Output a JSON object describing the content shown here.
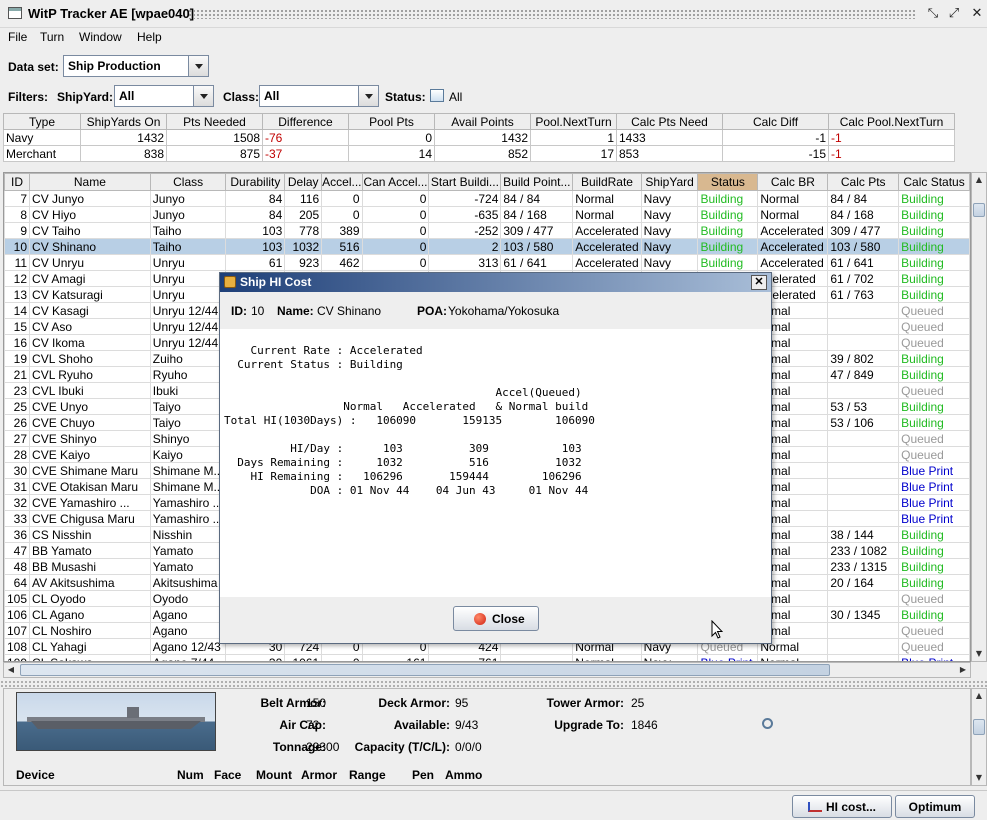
{
  "window": {
    "title": "WitP Tracker AE [wpae040]"
  },
  "menu": [
    "File",
    "Turn",
    "Window",
    "Help"
  ],
  "dataset": {
    "label": "Data set:",
    "value": "Ship Production"
  },
  "filters": {
    "label": "Filters:",
    "shipyard_label": "ShipYard:",
    "shipyard_value": "All",
    "class_label": "Class:",
    "class_value": "All",
    "status_label": "Status:",
    "status_value": "All"
  },
  "summary": {
    "headers": [
      "Type",
      "ShipYards On",
      "Pts Needed",
      "Difference",
      "Pool Pts",
      "Avail Points",
      "Pool.NextTurn",
      "Calc Pts Need",
      "Calc Diff",
      "Calc Pool.NextTurn"
    ],
    "rows": [
      [
        "Navy",
        "1432",
        "1508",
        "-76",
        "0",
        "1432",
        "1",
        "1433",
        "-1",
        "-1"
      ],
      [
        "Merchant",
        "838",
        "875",
        "-37",
        "14",
        "852",
        "17",
        "853",
        "-15",
        "-1"
      ]
    ]
  },
  "table": {
    "headers": [
      "ID",
      "Name",
      "Class",
      "Durability",
      "Delay",
      "Accel...",
      "Can Accel...",
      "Start Buildi...",
      "Build Point...",
      "BuildRate",
      "ShipYard",
      "Status",
      "Calc BR",
      "Calc Pts",
      "Calc Status"
    ],
    "rows": [
      [
        "7",
        "CV Junyo",
        "Junyo",
        "84",
        "116",
        "0",
        "0",
        "-724",
        "84 / 84",
        "Normal",
        "Navy",
        "Building",
        "Normal",
        "84 / 84",
        "Building"
      ],
      [
        "8",
        "CV Hiyo",
        "Junyo",
        "84",
        "205",
        "0",
        "0",
        "-635",
        "84 / 168",
        "Normal",
        "Navy",
        "Building",
        "Normal",
        "84 / 168",
        "Building"
      ],
      [
        "9",
        "CV Taiho",
        "Taiho",
        "103",
        "778",
        "389",
        "0",
        "-252",
        "309 / 477",
        "Accelerated",
        "Navy",
        "Building",
        "Accelerated",
        "309 / 477",
        "Building"
      ],
      [
        "10",
        "CV Shinano",
        "Taiho",
        "103",
        "1032",
        "516",
        "0",
        "2",
        "103 / 580",
        "Accelerated",
        "Navy",
        "Building",
        "Accelerated",
        "103 / 580",
        "Building"
      ],
      [
        "11",
        "CV Unryu",
        "Unryu",
        "61",
        "923",
        "462",
        "0",
        "313",
        "61 / 641",
        "Accelerated",
        "Navy",
        "Building",
        "Accelerated",
        "61 / 641",
        "Building"
      ],
      [
        "12",
        "CV Amagi",
        "Unryu",
        "",
        "",
        "",
        "",
        "",
        "",
        "",
        "",
        "",
        "ccelerated",
        "61 / 702",
        "Building"
      ],
      [
        "13",
        "CV Katsuragi",
        "Unryu",
        "",
        "",
        "",
        "",
        "",
        "",
        "",
        "",
        "",
        "ccelerated",
        "61 / 763",
        "Building"
      ],
      [
        "14",
        "CV Kasagi",
        "Unryu 12/44",
        "",
        "",
        "",
        "",
        "",
        "",
        "",
        "",
        "",
        "ormal",
        "",
        "Queued"
      ],
      [
        "15",
        "CV Aso",
        "Unryu 12/44",
        "",
        "",
        "",
        "",
        "",
        "",
        "",
        "",
        "",
        "ormal",
        "",
        "Queued"
      ],
      [
        "16",
        "CV Ikoma",
        "Unryu 12/44",
        "",
        "",
        "",
        "",
        "",
        "",
        "",
        "",
        "",
        "ormal",
        "",
        "Queued"
      ],
      [
        "19",
        "CVL Shoho",
        "Zuiho",
        "",
        "",
        "",
        "",
        "",
        "",
        "",
        "",
        "",
        "ormal",
        "39 / 802",
        "Building"
      ],
      [
        "21",
        "CVL Ryuho",
        "Ryuho",
        "",
        "",
        "",
        "",
        "",
        "",
        "",
        "",
        "",
        "ormal",
        "47 / 849",
        "Building"
      ],
      [
        "23",
        "CVL Ibuki",
        "Ibuki",
        "",
        "",
        "",
        "",
        "",
        "",
        "",
        "",
        "",
        "ormal",
        "",
        "Queued"
      ],
      [
        "25",
        "CVE Unyo",
        "Taiyo",
        "",
        "",
        "",
        "",
        "",
        "",
        "",
        "",
        "",
        "ormal",
        "53 / 53",
        "Building"
      ],
      [
        "26",
        "CVE Chuyo",
        "Taiyo",
        "",
        "",
        "",
        "",
        "",
        "",
        "",
        "",
        "",
        "ormal",
        "53 / 106",
        "Building"
      ],
      [
        "27",
        "CVE Shinyo",
        "Shinyo",
        "",
        "",
        "",
        "",
        "",
        "",
        "",
        "",
        "",
        "ormal",
        "",
        "Queued"
      ],
      [
        "28",
        "CVE Kaiyo",
        "Kaiyo",
        "",
        "",
        "",
        "",
        "",
        "",
        "",
        "",
        "",
        "ormal",
        "",
        "Queued"
      ],
      [
        "30",
        "CVE Shimane Maru",
        "Shimane M...",
        "",
        "",
        "",
        "",
        "",
        "",
        "",
        "",
        "",
        "ormal",
        "",
        "Blue Print"
      ],
      [
        "31",
        "CVE Otakisan Maru",
        "Shimane M...",
        "",
        "",
        "",
        "",
        "",
        "",
        "",
        "",
        "",
        "ormal",
        "",
        "Blue Print"
      ],
      [
        "32",
        "CVE Yamashiro ...",
        "Yamashiro ...",
        "",
        "",
        "",
        "",
        "",
        "",
        "",
        "",
        "",
        "ormal",
        "",
        "Blue Print"
      ],
      [
        "33",
        "CVE Chigusa Maru",
        "Yamashiro ...",
        "",
        "",
        "",
        "",
        "",
        "",
        "",
        "",
        "",
        "ormal",
        "",
        "Blue Print"
      ],
      [
        "36",
        "CS Nisshin",
        "Nisshin",
        "",
        "",
        "",
        "",
        "",
        "",
        "",
        "",
        "",
        "ormal",
        "38 / 144",
        "Building"
      ],
      [
        "47",
        "BB Yamato",
        "Yamato",
        "",
        "",
        "",
        "",
        "",
        "",
        "",
        "",
        "",
        "ormal",
        "233 / 1082",
        "Building"
      ],
      [
        "48",
        "BB Musashi",
        "Yamato",
        "",
        "",
        "",
        "",
        "",
        "",
        "",
        "",
        "",
        "ormal",
        "233 / 1315",
        "Building"
      ],
      [
        "64",
        "AV Akitsushima",
        "Akitsushima",
        "",
        "",
        "",
        "",
        "",
        "",
        "",
        "",
        "",
        "ormal",
        "20 / 164",
        "Building"
      ],
      [
        "105",
        "CL Oyodo",
        "Oyodo",
        "",
        "",
        "",
        "",
        "",
        "",
        "",
        "",
        "",
        "ormal",
        "",
        "Queued"
      ],
      [
        "106",
        "CL Agano",
        "Agano",
        "",
        "",
        "",
        "",
        "",
        "",
        "",
        "",
        "",
        "ormal",
        "30 / 1345",
        "Building"
      ],
      [
        "107",
        "CL Noshiro",
        "Agano",
        "",
        "",
        "",
        "",
        "",
        "",
        "",
        "",
        "",
        "ormal",
        "",
        "Queued"
      ],
      [
        "108",
        "CL Yahagi",
        "Agano 12/43",
        "30",
        "724",
        "0",
        "0",
        "424",
        "",
        "Normal",
        "Navy",
        "Queued",
        "Normal",
        "",
        "Queued"
      ],
      [
        "109",
        "CL Sakawa",
        "Agano 7/44",
        "30",
        "1061",
        "0",
        "161",
        "761",
        "",
        "Normal",
        "Navy",
        "Blue Print",
        "Normal",
        "",
        "Blue Print"
      ]
    ]
  },
  "detail": {
    "belt_armor_label": "Belt Armor:",
    "belt_armor": "150",
    "deck_armor_label": "Deck Armor:",
    "deck_armor": "95",
    "tower_armor_label": "Tower Armor:",
    "tower_armor": "25",
    "air_cap_label": "Air Cap:",
    "air_cap": "72",
    "available_label": "Available:",
    "available": "9/43",
    "upgrade_label": "Upgrade To:",
    "upgrade": "1846",
    "tonnage_label": "Tonnage:",
    "tonnage": "29300",
    "capacity_label": "Capacity (T/C/L):",
    "capacity": "0/0/0",
    "device_headers": [
      "Device",
      "Num",
      "Face",
      "Mount",
      "Armor",
      "Range",
      "Pen",
      "Ammo"
    ]
  },
  "buttons": {
    "hi_cost": "HI cost...",
    "optimum": "Optimum"
  },
  "dialog": {
    "title": "Ship HI Cost",
    "id_label": "ID:",
    "id": "10",
    "name_label": "Name:",
    "name": "CV Shinano",
    "poa_label": "POA:",
    "poa": "Yokohama/Yokosuka",
    "report": "    Current Rate : Accelerated\n  Current Status : Building\n\n                                         Accel(Queued)\n                  Normal   Accelerated   & Normal build\nTotal HI(1030Days) :   106090       159135        106090\n\n          HI/Day :      103          309           103\n  Days Remaining :     1032          516          1032\n    HI Remaining :   106296       159444        106296\n             DOA : 01 Nov 44    04 Jun 43     01 Nov 44",
    "close_label": "Close"
  }
}
